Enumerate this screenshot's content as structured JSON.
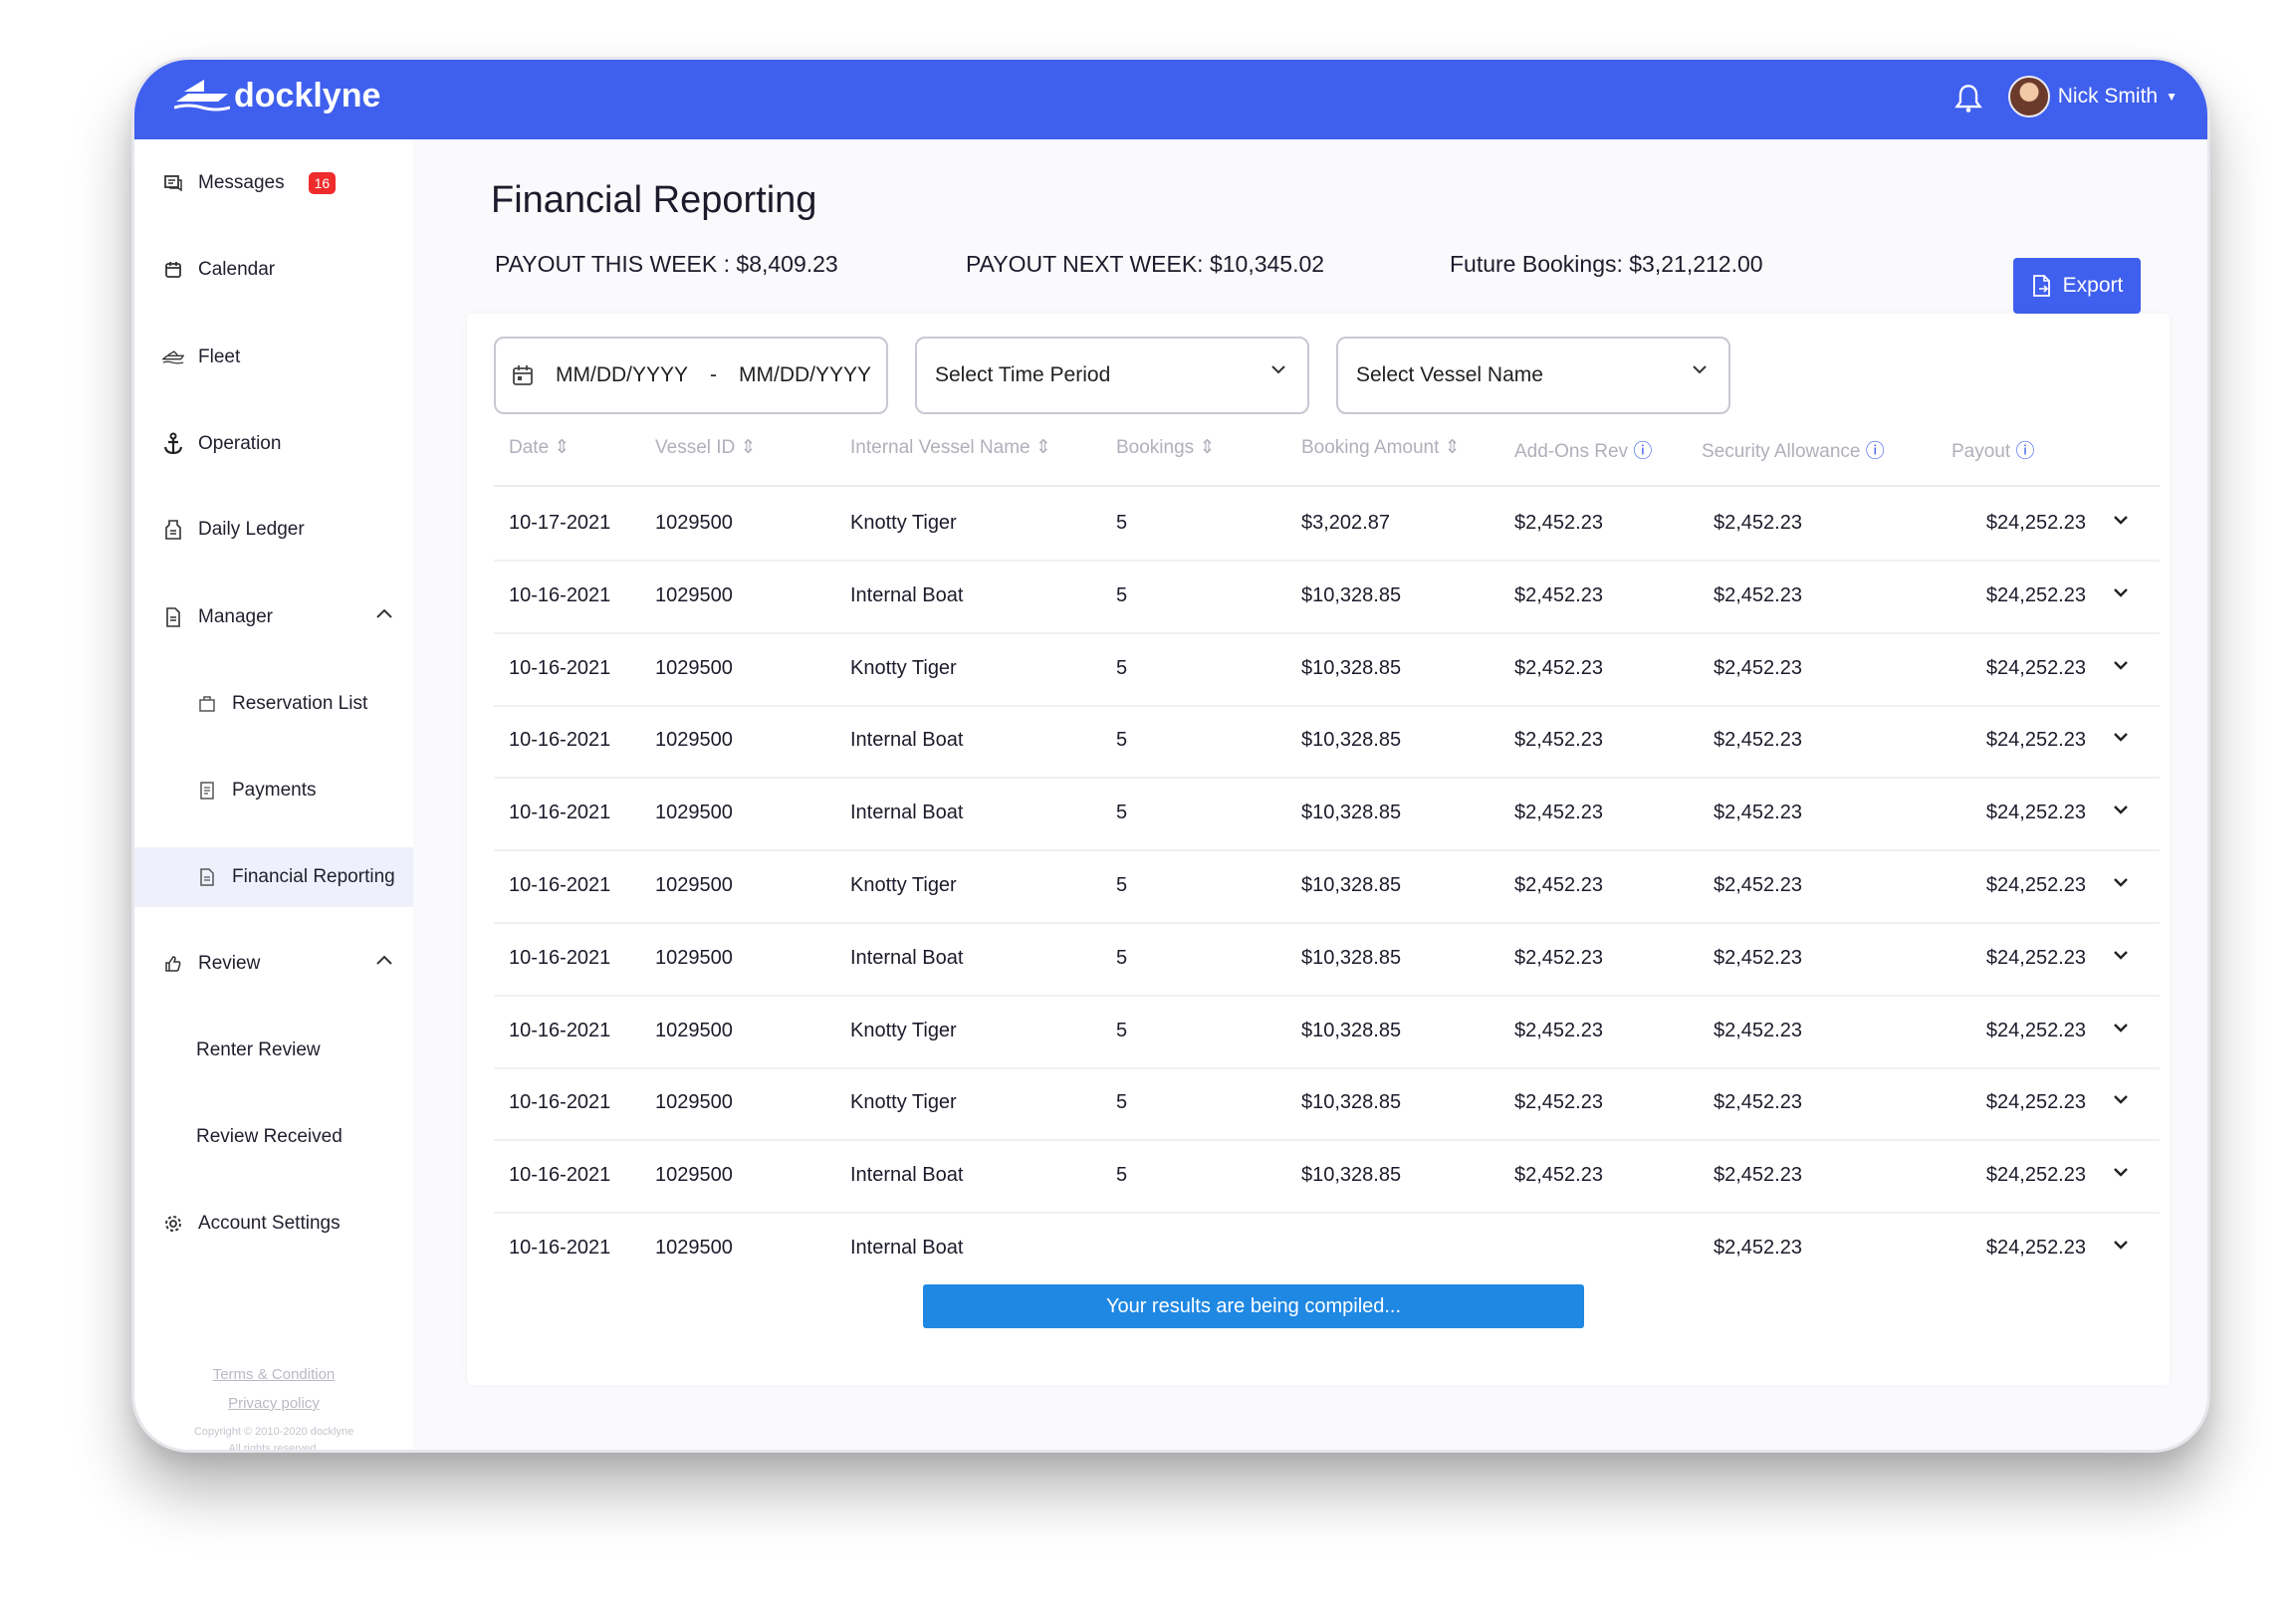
{
  "app": {
    "logo_text": "docklyne",
    "user_name": "Nick Smith"
  },
  "sidebar": {
    "items": [
      {
        "label": "Messages",
        "icon": "messages-icon",
        "badge": "16"
      },
      {
        "label": "Calendar",
        "icon": "calendar-icon"
      },
      {
        "label": "Fleet",
        "icon": "boat-icon"
      },
      {
        "label": "Operation",
        "icon": "anchor-icon"
      },
      {
        "label": "Daily Ledger",
        "icon": "ledger-icon"
      },
      {
        "label": "Manager",
        "icon": "document-icon"
      },
      {
        "label": "Reservation List",
        "icon": "reservation-icon"
      },
      {
        "label": "Payments",
        "icon": "payments-icon"
      },
      {
        "label": "Financial Reporting",
        "icon": "report-icon"
      },
      {
        "label": "Review",
        "icon": "thumbs-up-icon"
      },
      {
        "label": "Renter Review"
      },
      {
        "label": "Review Received"
      },
      {
        "label": "Account Settings",
        "icon": "gear-icon"
      }
    ],
    "footer": {
      "terms": "Terms & Condition",
      "privacy": "Privacy policy",
      "copyright_1": "Copyright © 2010-2020 docklyne",
      "copyright_2": "All rights reserved."
    }
  },
  "page": {
    "title": "Financial Reporting",
    "payout_this_week": "PAYOUT THIS WEEK : $8,409.23",
    "payout_next_week": "PAYOUT NEXT WEEK: $10,345.02",
    "future_bookings": "Future Bookings: $3,21,212.00",
    "export_label": "Export"
  },
  "filters": {
    "date_from": "MM/DD/YYYY",
    "date_sep": "-",
    "date_to": "MM/DD/YYYY",
    "time_period": "Select Time Period",
    "vessel_name": "Select Vessel Name"
  },
  "table": {
    "columns": [
      "Date",
      "Vessel ID",
      "Internal Vessel Name",
      "Bookings",
      "Booking Amount",
      "Add-Ons Rev",
      "Security Allowance",
      "Payout"
    ],
    "rows": [
      [
        "10-17-2021",
        "1029500",
        "Knotty Tiger",
        "5",
        "$3,202.87",
        "$2,452.23",
        "$2,452.23",
        "$24,252.23"
      ],
      [
        "10-16-2021",
        "1029500",
        "Internal Boat",
        "5",
        "$10,328.85",
        "$2,452.23",
        "$2,452.23",
        "$24,252.23"
      ],
      [
        "10-16-2021",
        "1029500",
        "Knotty Tiger",
        "5",
        "$10,328.85",
        "$2,452.23",
        "$2,452.23",
        "$24,252.23"
      ],
      [
        "10-16-2021",
        "1029500",
        "Internal Boat",
        "5",
        "$10,328.85",
        "$2,452.23",
        "$2,452.23",
        "$24,252.23"
      ],
      [
        "10-16-2021",
        "1029500",
        "Internal Boat",
        "5",
        "$10,328.85",
        "$2,452.23",
        "$2,452.23",
        "$24,252.23"
      ],
      [
        "10-16-2021",
        "1029500",
        "Knotty Tiger",
        "5",
        "$10,328.85",
        "$2,452.23",
        "$2,452.23",
        "$24,252.23"
      ],
      [
        "10-16-2021",
        "1029500",
        "Internal Boat",
        "5",
        "$10,328.85",
        "$2,452.23",
        "$2,452.23",
        "$24,252.23"
      ],
      [
        "10-16-2021",
        "1029500",
        "Knotty Tiger",
        "5",
        "$10,328.85",
        "$2,452.23",
        "$2,452.23",
        "$24,252.23"
      ],
      [
        "10-16-2021",
        "1029500",
        "Knotty Tiger",
        "5",
        "$10,328.85",
        "$2,452.23",
        "$2,452.23",
        "$24,252.23"
      ],
      [
        "10-16-2021",
        "1029500",
        "Internal Boat",
        "5",
        "$10,328.85",
        "$2,452.23",
        "$2,452.23",
        "$24,252.23"
      ],
      [
        "10-16-2021",
        "1029500",
        "Internal Boat",
        "",
        "",
        "",
        "$2,452.23",
        "$24,252.23"
      ]
    ]
  },
  "toast": "Your results are being compiled...",
  "colors": {
    "primary": "#3f5fee",
    "badge": "#ef2b2b",
    "toast": "#1f88e3"
  }
}
